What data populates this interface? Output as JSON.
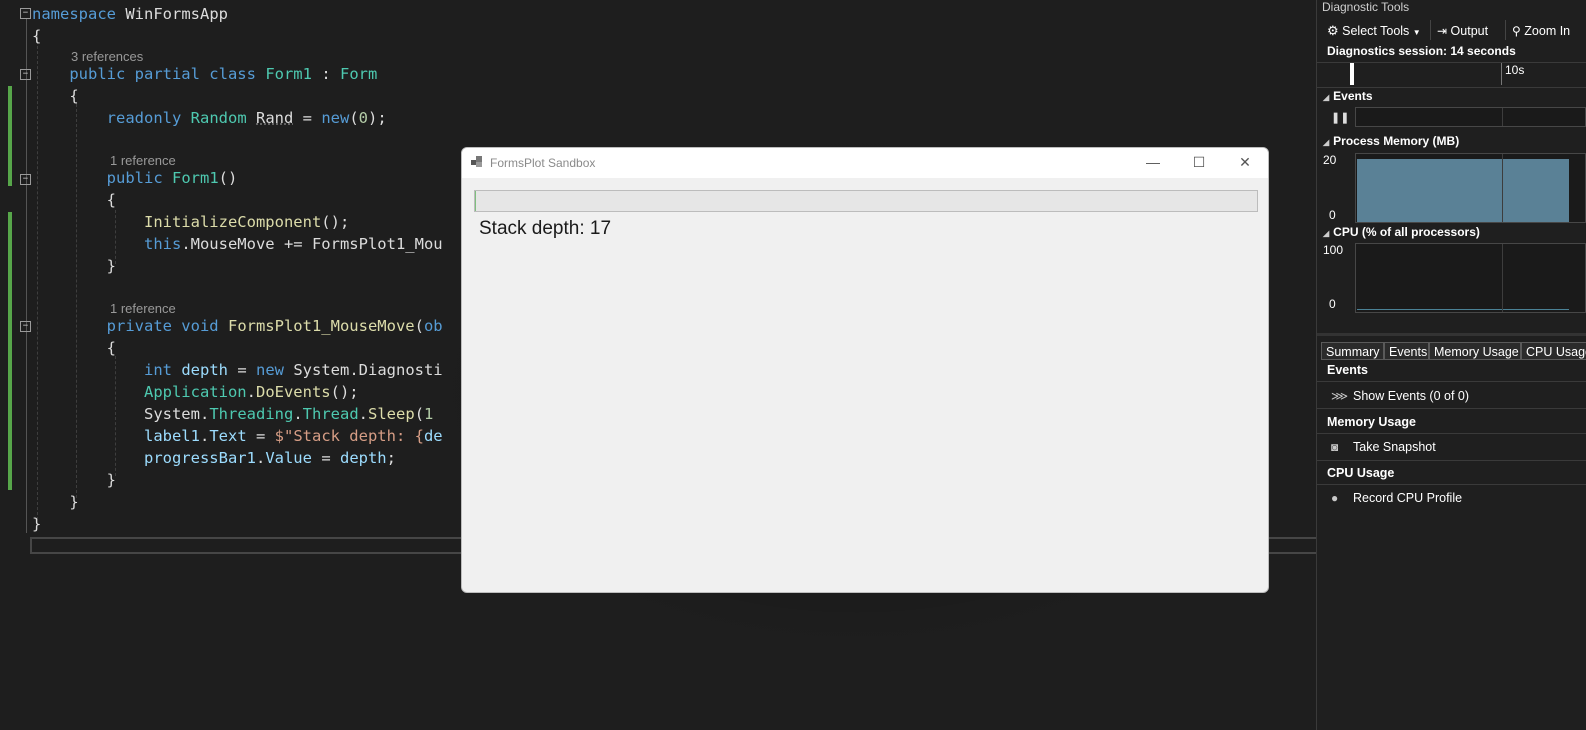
{
  "editor": {
    "lines": {
      "l1_kw": "namespace",
      "l1_name": "WinFormsApp",
      "l3_lens": "3 references",
      "l3_kw": "public partial class",
      "l3_type": "Form1",
      "l3_colon": " : ",
      "l3_base": "Form",
      "l5_kw": "readonly",
      "l5_type": "Random",
      "l5_id": "Rand",
      "l5_eq": " = ",
      "l5_new": "new",
      "l5_arg": "0",
      "l7_lens": "1 reference",
      "l7_kw": "public",
      "l7_type": "Form1",
      "l9_fn": "InitializeComponent",
      "l10_this": "this",
      "l10_rest": ".MouseMove += FormsPlot1_Mou",
      "l12_lens": "1 reference",
      "l12_kw": "private void",
      "l12_fn": "FormsPlot1_MouseMove",
      "l12_tail": "ob",
      "l14_kw": "int",
      "l14_id": "depth",
      "l14_new": "new",
      "l14_rest": " System.Diagnosti",
      "l15_type": "Application",
      "l15_fn": "DoEvents",
      "l16_a": "System",
      "l16_b": "Threading",
      "l16_c": "Thread",
      "l16_fn": "Sleep",
      "l16_arg": "1",
      "l17_id": "label1",
      "l17_prop": "Text",
      "l17_str": "$\"Stack depth: {",
      "l17_tail": "de",
      "l18_id": "progressBar1",
      "l18_prop": "Value",
      "l18_val": "depth"
    }
  },
  "window": {
    "title": "FormsPlot Sandbox",
    "minimize": "—",
    "maximize": "☐",
    "close": "✕",
    "progress_fraction": 0.0,
    "label_prefix": "Stack depth: ",
    "depth": "17"
  },
  "diagnostics": {
    "title": "Diagnostic Tools",
    "toolbar": {
      "select_tools": "Select Tools",
      "output": "Output",
      "zoom_in": "Zoom In"
    },
    "session": "Diagnostics session: 14 seconds",
    "timeline_tick": "10s",
    "events_label": "Events",
    "memory_label": "Process Memory (MB)",
    "memory_axis": {
      "max": "20",
      "min": "0"
    },
    "cpu_label": "CPU (% of all processors)",
    "cpu_axis": {
      "max": "100",
      "min": "0"
    },
    "tabs": [
      "Summary",
      "Events",
      "Memory Usage",
      "CPU Usage"
    ],
    "bottom": {
      "events_head": "Events",
      "events_item": "Show Events (0 of 0)",
      "memory_head": "Memory Usage",
      "memory_item": "Take Snapshot",
      "cpu_head": "CPU Usage",
      "cpu_item": "Record CPU Profile"
    },
    "colors": {
      "memory_fill": "#5a8196",
      "cpu_line": "#4b8296"
    }
  }
}
